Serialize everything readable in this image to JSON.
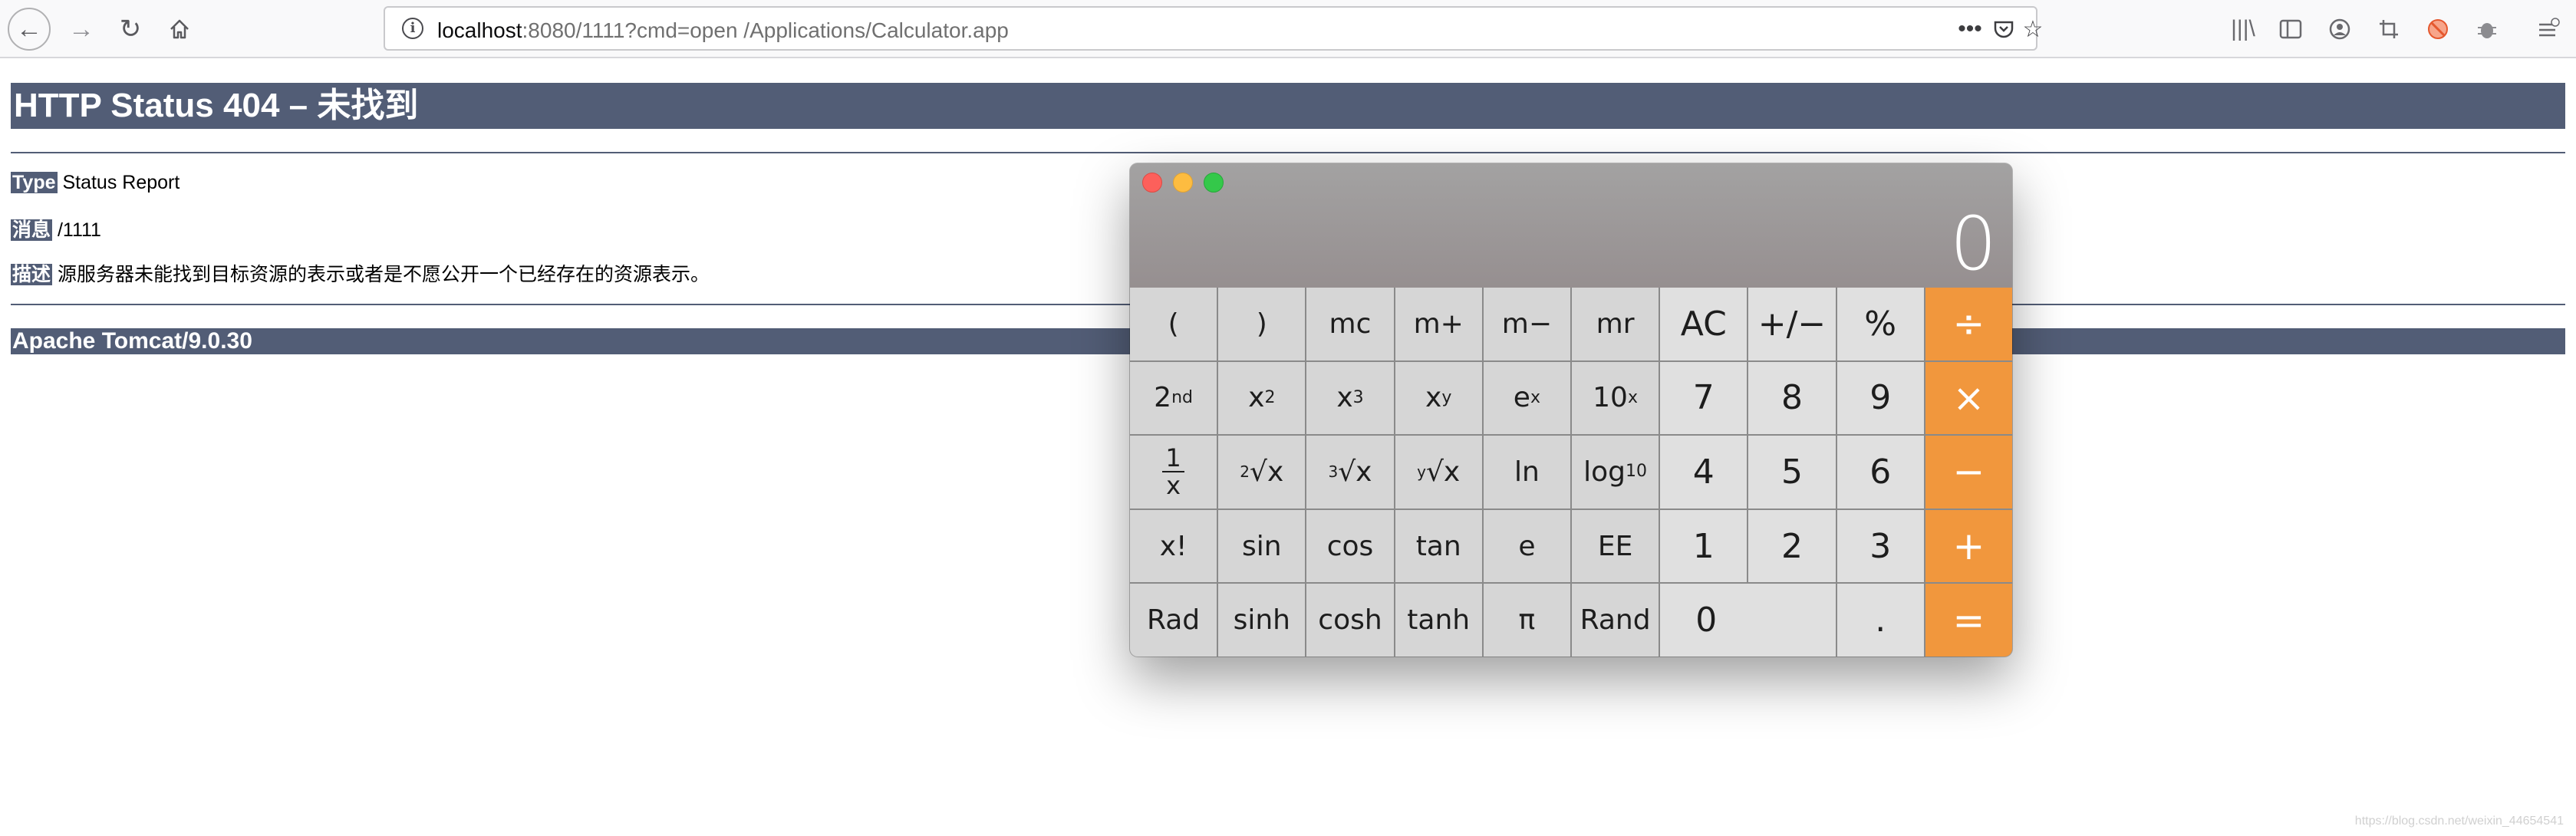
{
  "browser": {
    "url_host": "localhost",
    "url_rest": ":8080/1111?cmd=open /Applications/Calculator.app",
    "page_actions_icon": "ellipsis-icon",
    "icons_right": [
      "library-icon",
      "sidebar-icon",
      "account-icon",
      "screenshot-icon",
      "tracking-blocked-icon",
      "extension-bug-icon",
      "menu-icon"
    ]
  },
  "page": {
    "title": "HTTP Status 404 – 未找到",
    "type_label": "Type",
    "type_value": " Status Report",
    "message_label": "消息",
    "message_value": " /1111",
    "desc_label": "描述",
    "desc_value": " 源服务器未能找到目标资源的表示或者是不愿公开一个已经存在的资源表示。",
    "footer": "Apache Tomcat/9.0.30"
  },
  "calculator": {
    "display": "0",
    "row1": [
      "(",
      ")",
      "mc",
      "m+",
      "m−",
      "mr",
      "AC",
      "+/−",
      "%",
      "÷"
    ],
    "row2_digits": [
      "7",
      "8",
      "9"
    ],
    "row2_op": "×",
    "row3_funcs": [
      "ln"
    ],
    "row3_digits": [
      "4",
      "5",
      "6"
    ],
    "row3_op": "−",
    "row4": [
      "x!",
      "sin",
      "cos",
      "tan",
      "e",
      "EE"
    ],
    "row4_digits": [
      "1",
      "2",
      "3"
    ],
    "row4_op": "+",
    "row5": [
      "Rad",
      "sinh",
      "cosh",
      "tanh",
      "π",
      "Rand"
    ],
    "row5_zero": "0",
    "row5_dot": ".",
    "row5_op": "=",
    "accent_color": "#f1973d"
  },
  "watermark": "https://blog.csdn.net/weixin_44654541"
}
